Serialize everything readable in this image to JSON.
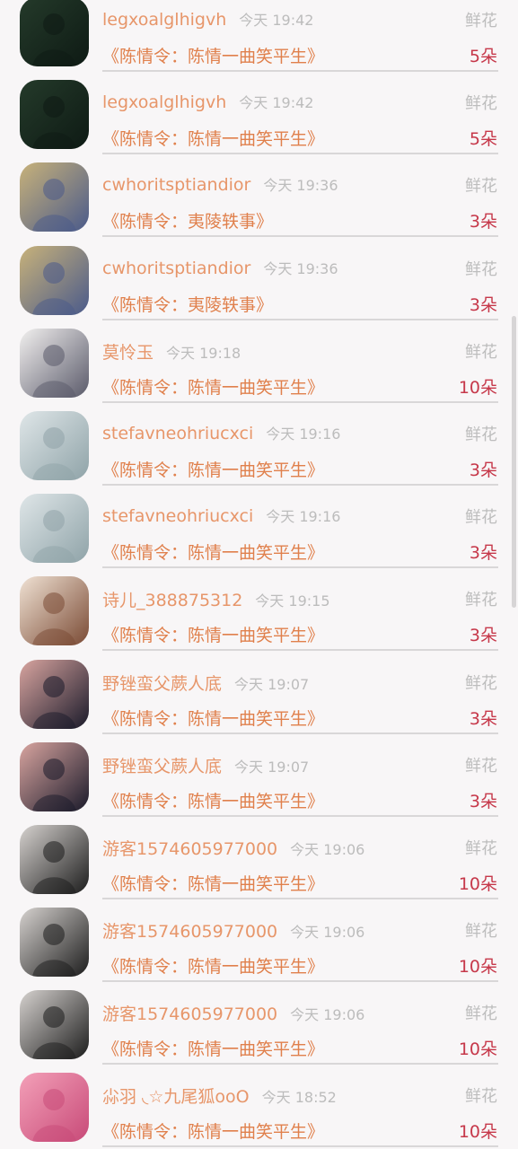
{
  "gift_type": "鲜花",
  "rows": [
    {
      "user": "legxoalglhigvh",
      "time": "今天 19:42",
      "drama": "《陈情令：陈情一曲笑平生》",
      "count": "5朵",
      "avatar": "dark-dancer-photo",
      "c1": "#243a2a",
      "c2": "#0e1a14"
    },
    {
      "user": "legxoalglhigvh",
      "time": "今天 19:42",
      "drama": "《陈情令：陈情一曲笑平生》",
      "count": "5朵",
      "avatar": "dark-dancer-photo",
      "c1": "#243a2a",
      "c2": "#0e1a14"
    },
    {
      "user": "cwhoritsptiandior",
      "time": "今天 19:36",
      "drama": "《陈情令：夷陵轶事》",
      "count": "3朵",
      "avatar": "game-warrior-portrait",
      "c1": "#c8b27a",
      "c2": "#4a5a8a"
    },
    {
      "user": "cwhoritsptiandior",
      "time": "今天 19:36",
      "drama": "《陈情令：夷陵轶事》",
      "count": "3朵",
      "avatar": "game-warrior-portrait",
      "c1": "#c8b27a",
      "c2": "#4a5a8a"
    },
    {
      "user": "莫怜玉",
      "time": "今天 19:18",
      "drama": "《陈情令：陈情一曲笑平生》",
      "count": "10朵",
      "avatar": "ink-art-illustration",
      "c1": "#f2f0ef",
      "c2": "#5a5a6a"
    },
    {
      "user": "stefavneohriucxci",
      "time": "今天 19:16",
      "drama": "《陈情令：陈情一曲笑平生》",
      "count": "3朵",
      "avatar": "cherry-blossom-city",
      "c1": "#dfe6e8",
      "c2": "#8fa3a8"
    },
    {
      "user": "stefavneohriucxci",
      "time": "今天 19:16",
      "drama": "《陈情令：陈情一曲笑平生》",
      "count": "3朵",
      "avatar": "cherry-blossom-city",
      "c1": "#dfe6e8",
      "c2": "#8fa3a8"
    },
    {
      "user": "诗儿_388875312",
      "time": "今天 19:15",
      "drama": "《陈情令：陈情一曲笑平生》",
      "count": "3朵",
      "avatar": "woman-portrait-soft",
      "c1": "#f0e2d4",
      "c2": "#7a4a34"
    },
    {
      "user": "野锉蛮父蕨人底",
      "time": "今天 19:07",
      "drama": "《陈情令：陈情一曲笑平生》",
      "count": "3朵",
      "avatar": "couple-sunset-silhouette",
      "c1": "#d9a5a0",
      "c2": "#1a1a2a"
    },
    {
      "user": "野锉蛮父蕨人底",
      "time": "今天 19:07",
      "drama": "《陈情令：陈情一曲笑平生》",
      "count": "3朵",
      "avatar": "couple-sunset-silhouette",
      "c1": "#d9a5a0",
      "c2": "#1a1a2a"
    },
    {
      "user": "游客1574605977000",
      "time": "今天 19:06",
      "drama": "《陈情令：陈情一曲笑平生》",
      "count": "10朵",
      "avatar": "woman-selfie",
      "c1": "#d6d2cf",
      "c2": "#1c1c1c"
    },
    {
      "user": "游客1574605977000",
      "time": "今天 19:06",
      "drama": "《陈情令：陈情一曲笑平生》",
      "count": "10朵",
      "avatar": "woman-selfie",
      "c1": "#d6d2cf",
      "c2": "#1c1c1c"
    },
    {
      "user": "游客1574605977000",
      "time": "今天 19:06",
      "drama": "《陈情令：陈情一曲笑平生》",
      "count": "10朵",
      "avatar": "woman-selfie",
      "c1": "#d6d2cf",
      "c2": "#1c1c1c"
    },
    {
      "user": "尛羽 ◟☆九尾狐ooO",
      "time": "今天 18:52",
      "drama": "《陈情令：陈情一曲笑平生》",
      "count": "10朵",
      "avatar": "pink-blossom-photo",
      "c1": "#f3a0b8",
      "c2": "#c84a78"
    }
  ]
}
